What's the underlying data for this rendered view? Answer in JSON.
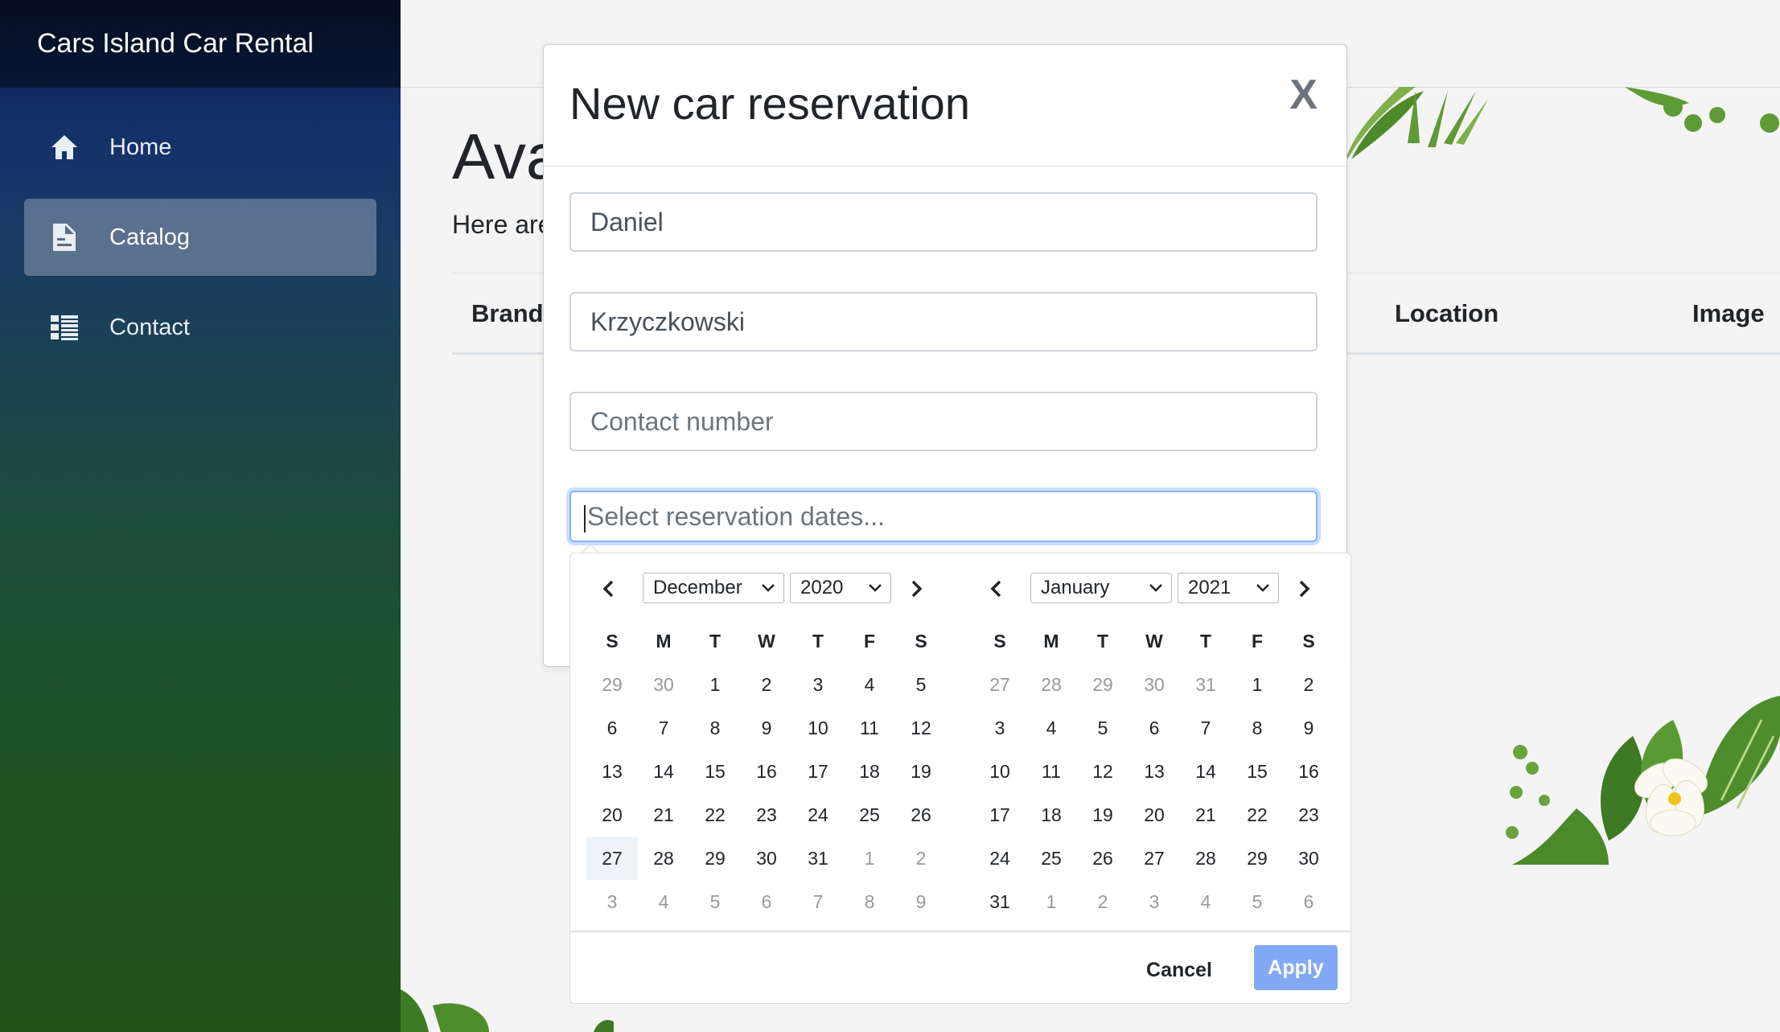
{
  "app": {
    "title": "Cars Island Car Rental"
  },
  "sidebar": {
    "items": [
      {
        "label": "Home",
        "icon": "home-icon"
      },
      {
        "label": "Catalog",
        "icon": "document-icon",
        "active": true
      },
      {
        "label": "Contact",
        "icon": "list-icon"
      }
    ]
  },
  "page": {
    "title": "Ava",
    "lead": "Here are",
    "columns": [
      "Brand",
      "Location",
      "Image"
    ]
  },
  "modal": {
    "title": "New car reservation",
    "close_label": "X",
    "first_name_value": "Daniel",
    "last_name_value": "Krzyczkowski",
    "contact_placeholder": "Contact number",
    "dates_placeholder": "Select reservation dates..."
  },
  "datepicker": {
    "weekdays": [
      "S",
      "M",
      "T",
      "W",
      "T",
      "F",
      "S"
    ],
    "left": {
      "month": "December",
      "year": "2020",
      "weeks": [
        [
          [
            "29",
            1
          ],
          [
            "30",
            1
          ],
          [
            "1",
            0
          ],
          [
            "2",
            0
          ],
          [
            "3",
            0
          ],
          [
            "4",
            0
          ],
          [
            "5",
            0
          ]
        ],
        [
          [
            "6",
            0
          ],
          [
            "7",
            0
          ],
          [
            "8",
            0
          ],
          [
            "9",
            0
          ],
          [
            "10",
            0
          ],
          [
            "11",
            0
          ],
          [
            "12",
            0
          ]
        ],
        [
          [
            "13",
            0
          ],
          [
            "14",
            0
          ],
          [
            "15",
            0
          ],
          [
            "16",
            0
          ],
          [
            "17",
            0
          ],
          [
            "18",
            0
          ],
          [
            "19",
            0
          ]
        ],
        [
          [
            "20",
            0
          ],
          [
            "21",
            0
          ],
          [
            "22",
            0
          ],
          [
            "23",
            0
          ],
          [
            "24",
            0
          ],
          [
            "25",
            0
          ],
          [
            "26",
            0
          ]
        ],
        [
          [
            "27",
            2
          ],
          [
            "28",
            0
          ],
          [
            "29",
            0
          ],
          [
            "30",
            0
          ],
          [
            "31",
            0
          ],
          [
            "1",
            1
          ],
          [
            "2",
            1
          ]
        ],
        [
          [
            "3",
            1
          ],
          [
            "4",
            1
          ],
          [
            "5",
            1
          ],
          [
            "6",
            1
          ],
          [
            "7",
            1
          ],
          [
            "8",
            1
          ],
          [
            "9",
            1
          ]
        ]
      ]
    },
    "right": {
      "month": "January",
      "year": "2021",
      "weeks": [
        [
          [
            "27",
            1
          ],
          [
            "28",
            1
          ],
          [
            "29",
            1
          ],
          [
            "30",
            1
          ],
          [
            "31",
            1
          ],
          [
            "1",
            0
          ],
          [
            "2",
            0
          ]
        ],
        [
          [
            "3",
            0
          ],
          [
            "4",
            0
          ],
          [
            "5",
            0
          ],
          [
            "6",
            0
          ],
          [
            "7",
            0
          ],
          [
            "8",
            0
          ],
          [
            "9",
            0
          ]
        ],
        [
          [
            "10",
            0
          ],
          [
            "11",
            0
          ],
          [
            "12",
            0
          ],
          [
            "13",
            0
          ],
          [
            "14",
            0
          ],
          [
            "15",
            0
          ],
          [
            "16",
            0
          ]
        ],
        [
          [
            "17",
            0
          ],
          [
            "18",
            0
          ],
          [
            "19",
            0
          ],
          [
            "20",
            0
          ],
          [
            "21",
            0
          ],
          [
            "22",
            0
          ],
          [
            "23",
            0
          ]
        ],
        [
          [
            "24",
            0
          ],
          [
            "25",
            0
          ],
          [
            "26",
            0
          ],
          [
            "27",
            0
          ],
          [
            "28",
            0
          ],
          [
            "29",
            0
          ],
          [
            "30",
            0
          ]
        ],
        [
          [
            "31",
            0
          ],
          [
            "1",
            1
          ],
          [
            "2",
            1
          ],
          [
            "3",
            1
          ],
          [
            "4",
            1
          ],
          [
            "5",
            1
          ],
          [
            "6",
            1
          ]
        ]
      ]
    },
    "cancel_label": "Cancel",
    "apply_label": "Apply"
  },
  "colors": {
    "sidebar_top": "#0b1a40",
    "sidebar_bottom": "#225118",
    "apply_button": "#82a9f4",
    "today_highlight": "#eef3f7",
    "focus_ring": "#86b7fe"
  }
}
